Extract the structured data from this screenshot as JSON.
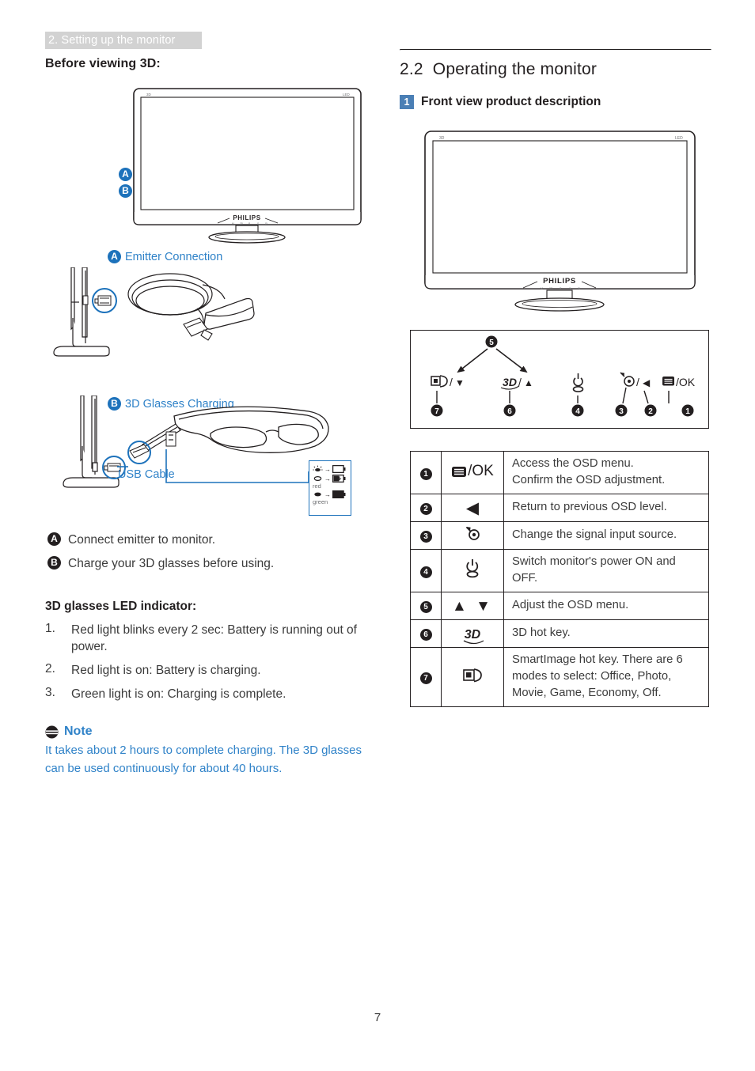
{
  "header": {
    "running_title": "2. Setting up the monitor"
  },
  "page": {
    "number": "7"
  },
  "colors": {
    "accent_blue": "#2f82c8",
    "marker_blue": "#1d72bb",
    "badge_blue": "#4a7fb5",
    "header_gray": "#d2d2d2",
    "body_text": "#3b3b3b"
  },
  "left": {
    "subheading": "Before viewing 3D:",
    "markers": [
      {
        "letter": "A",
        "label": "Emitter Connection"
      },
      {
        "letter": "B",
        "label": "3D Glasses Charging"
      }
    ],
    "monitor_brand": "PHILIPS",
    "usb_cable_label": "USB Cable",
    "led_legend": [
      {
        "state": "blink",
        "battery": "empty",
        "sub": ""
      },
      {
        "state": "solid",
        "battery": "charging",
        "sub": "red"
      },
      {
        "state": "solid",
        "battery": "full",
        "sub": "green"
      }
    ],
    "steps": [
      {
        "letter": "A",
        "text": "Connect emitter to monitor."
      },
      {
        "letter": "B",
        "text": "Charge your 3D glasses before using."
      }
    ],
    "led_heading": "3D glasses LED indicator:",
    "led_items": [
      {
        "n": "1.",
        "text": "Red light blinks every 2 sec: Battery is running out of power."
      },
      {
        "n": "2.",
        "text": "Red light is on: Battery is charging."
      },
      {
        "n": "3.",
        "text": "Green light is on: Charging is complete."
      }
    ],
    "note": {
      "title": "Note",
      "body": "It takes about 2 hours to complete charging. The 3D glasses can be used continuously for about 40 hours."
    }
  },
  "right": {
    "section_number": "2.2",
    "section_title": "Operating the monitor",
    "subsection_badge": "1",
    "subsection_title": "Front view product description",
    "monitor_brand": "PHILIPS",
    "panel_controls": [
      {
        "number": "7",
        "glyph": "smartimage",
        "text": "/▼"
      },
      {
        "number": "6",
        "glyph": "3d",
        "text": "3D/▲"
      },
      {
        "number": "4",
        "glyph": "power",
        "text": ""
      },
      {
        "number": "3",
        "glyph": "source",
        "text": ""
      },
      {
        "number": "2",
        "glyph": "left",
        "text": "/◀"
      },
      {
        "number": "1",
        "glyph": "osd",
        "text": "/OK"
      }
    ],
    "panel_top_number": "5",
    "table_rows": [
      {
        "num": "1",
        "icon": "osd-ok",
        "icon_text": "/OK",
        "desc": "Access the OSD menu.\nConfirm the OSD adjustment."
      },
      {
        "num": "2",
        "icon": "left-triangle",
        "icon_text": "◀",
        "desc": "Return to previous OSD level."
      },
      {
        "num": "3",
        "icon": "input-source",
        "icon_text": "",
        "desc": "Change the signal input source."
      },
      {
        "num": "4",
        "icon": "power",
        "icon_text": "",
        "desc": "Switch monitor's power ON and OFF."
      },
      {
        "num": "5",
        "icon": "up-down-triangles",
        "icon_text": "▲ ▼",
        "desc": "Adjust the OSD menu."
      },
      {
        "num": "6",
        "icon": "3d-hotkey",
        "icon_text": "3D",
        "desc": "3D hot key."
      },
      {
        "num": "7",
        "icon": "smartimage",
        "icon_text": "",
        "desc": "SmartImage hot key. There are 6 modes to select: Office, Photo, Movie, Game, Economy, Off."
      }
    ]
  }
}
